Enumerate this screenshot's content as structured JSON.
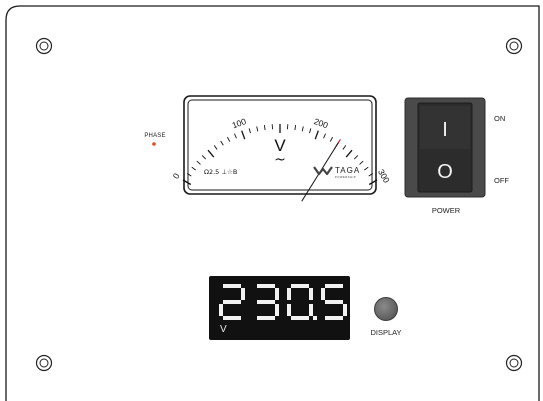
{
  "panel": {
    "phase_label": "PHASE",
    "phase_indicator_color": "#e04a2a",
    "frame_color": "#1a1a1a"
  },
  "meter": {
    "scale_labels": [
      "0",
      "100",
      "200",
      "300"
    ],
    "unit_symbol": "V",
    "ac_symbol": "~",
    "spec_text": "Ω2.5 ⊥☆B",
    "brand": "TAGA",
    "brand_sub": "POWERSHIP",
    "scale_max": 300,
    "needle_value": 230,
    "red_mark_value": 230,
    "red_mark_color": "#d2161c"
  },
  "power_switch": {
    "on_symbol": "I",
    "off_symbol": "O",
    "on_label": "ON",
    "off_label": "OFF",
    "label": "POWER",
    "state": "off"
  },
  "display": {
    "value": "230.5",
    "unit": "V",
    "button_label": "DISPLAY",
    "segment_color": "#f2f2f2",
    "background_color": "#111111"
  },
  "screws": [
    "screw-top-left",
    "screw-top-right",
    "screw-bottom-left",
    "screw-bottom-right"
  ]
}
